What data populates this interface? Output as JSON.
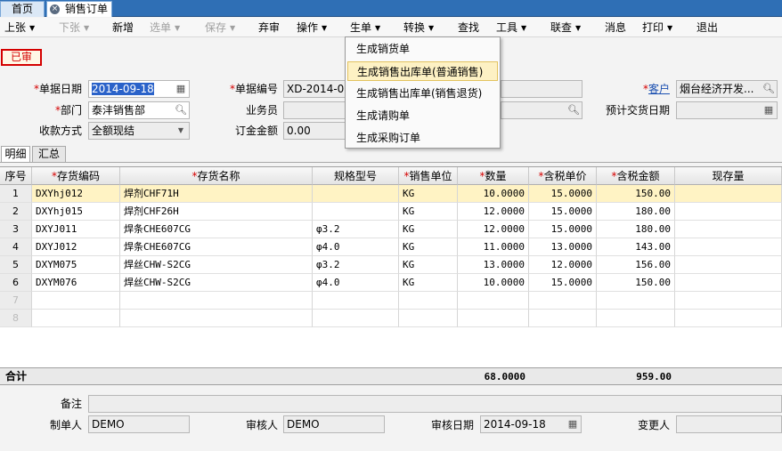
{
  "tabs": {
    "home": "首页",
    "order": "销售订单"
  },
  "toolbar": [
    {
      "label": "上张",
      "dropdown": true,
      "disabled": false
    },
    {
      "label": "下张",
      "dropdown": true,
      "disabled": true
    },
    {
      "label": "新增",
      "dropdown": false,
      "disabled": false
    },
    {
      "label": "选单",
      "dropdown": true,
      "disabled": true
    },
    {
      "label": "保存",
      "dropdown": true,
      "disabled": true
    },
    {
      "label": "弃审",
      "dropdown": false,
      "disabled": false
    },
    {
      "label": "操作",
      "dropdown": true,
      "disabled": false
    },
    {
      "label": "生单",
      "dropdown": true,
      "disabled": false
    },
    {
      "label": "转换",
      "dropdown": true,
      "disabled": false
    },
    {
      "label": "查找",
      "dropdown": false,
      "disabled": false
    },
    {
      "label": "工具",
      "dropdown": true,
      "disabled": false
    },
    {
      "label": "联查",
      "dropdown": true,
      "disabled": false
    },
    {
      "label": "消息",
      "dropdown": false,
      "disabled": false
    },
    {
      "label": "打印",
      "dropdown": true,
      "disabled": false
    },
    {
      "label": "退出",
      "dropdown": false,
      "disabled": false
    }
  ],
  "status_badge": "已审",
  "form": {
    "date_label": "单据日期",
    "date_value": "2014-09-18",
    "number_label": "单据编号",
    "number_value": "XD-2014-09",
    "customer_label": "客户",
    "customer_value": "烟台经济开发...",
    "dept_label": "部门",
    "dept_value": "泰沣销售部",
    "salesman_label": "业务员",
    "salesman_value": "",
    "delivery_label": "预计交货日期",
    "delivery_value": "",
    "payment_label": "收款方式",
    "payment_value": "全额现结",
    "deposit_label": "订金金额",
    "deposit_value": "0.00"
  },
  "subtabs": {
    "detail": "明细",
    "summary": "汇总"
  },
  "dropdown_menu": [
    "生成销货单",
    "生成销售出库单(普通销售)",
    "生成销售出库单(销售退货)",
    "生成请购单",
    "生成采购订单"
  ],
  "table": {
    "headers": [
      "序号",
      "存货编码",
      "存货名称",
      "规格型号",
      "销售单位",
      "数量",
      "含税单价",
      "含税金额",
      "现存量"
    ],
    "rows": [
      {
        "seq": "1",
        "code": "DXYhj012",
        "name": "焊剂CHF71H",
        "spec": "",
        "unit": "KG",
        "qty": "10.0000",
        "price": "15.0000",
        "amount": "150.00",
        "stock": ""
      },
      {
        "seq": "2",
        "code": "DXYhj015",
        "name": "焊剂CHF26H",
        "spec": "",
        "unit": "KG",
        "qty": "12.0000",
        "price": "15.0000",
        "amount": "180.00",
        "stock": ""
      },
      {
        "seq": "3",
        "code": "DXYJ011",
        "name": "焊条CHE607CG",
        "spec": "φ3.2",
        "unit": "KG",
        "qty": "12.0000",
        "price": "15.0000",
        "amount": "180.00",
        "stock": ""
      },
      {
        "seq": "4",
        "code": "DXYJ012",
        "name": "焊条CHE607CG",
        "spec": "φ4.0",
        "unit": "KG",
        "qty": "11.0000",
        "price": "13.0000",
        "amount": "143.00",
        "stock": ""
      },
      {
        "seq": "5",
        "code": "DXYM075",
        "name": "焊丝CHW-S2CG",
        "spec": "φ3.2",
        "unit": "KG",
        "qty": "13.0000",
        "price": "12.0000",
        "amount": "156.00",
        "stock": ""
      },
      {
        "seq": "6",
        "code": "DXYM076",
        "name": "焊丝CHW-S2CG",
        "spec": "φ4.0",
        "unit": "KG",
        "qty": "10.0000",
        "price": "15.0000",
        "amount": "150.00",
        "stock": ""
      },
      {
        "seq": "7",
        "code": "",
        "name": "",
        "spec": "",
        "unit": "",
        "qty": "",
        "price": "",
        "amount": "",
        "stock": ""
      },
      {
        "seq": "8",
        "code": "",
        "name": "",
        "spec": "",
        "unit": "",
        "qty": "",
        "price": "",
        "amount": "",
        "stock": ""
      }
    ],
    "total_label": "合计",
    "total_qty": "68.0000",
    "total_amount": "959.00"
  },
  "footer": {
    "remark_label": "备注",
    "remark_value": "",
    "maker_label": "制单人",
    "maker_value": "DEMO",
    "auditor_label": "审核人",
    "auditor_value": "DEMO",
    "audit_date_label": "审核日期",
    "audit_date_value": "2014-09-18",
    "changer_label": "变更人",
    "changer_value": ""
  },
  "icons": {
    "calendar": "calendar-icon",
    "search": "search-icon",
    "close": "close-icon",
    "dropdown": "chevron-down-icon"
  },
  "colors": {
    "status_red": "#d40000",
    "selected_row": "#fff3c4",
    "tab_blue": "#2f6fb5",
    "menu_hover": "#fdf1c4"
  }
}
